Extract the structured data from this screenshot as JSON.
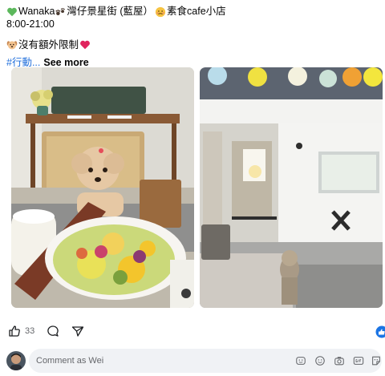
{
  "post": {
    "line1_text_a": "Wanaka",
    "line1_text_b": "灣仔景星街 (藍屋）",
    "line1_text_c": "素食cafe小店",
    "hours": "8:00-21:00",
    "line3_text": "沒有額外限制",
    "hashtag": "#行動...",
    "see_more": "See more"
  },
  "photos": [
    {
      "name": "dog-cafe-table-photo"
    },
    {
      "name": "cafe-storefront-photo"
    }
  ],
  "actions": {
    "like_count": "33"
  },
  "comment": {
    "placeholder": "Comment as Wei"
  },
  "colors": {
    "hashtag": "#216fdb",
    "like_blue": "#1b74e4",
    "muted": "#65676b",
    "comment_bg": "#f0f2f5"
  },
  "icons": {
    "heart": "green-heart-icon",
    "paws": "paw-prints-icon",
    "face": "face-icon",
    "dog": "dog-face-icon",
    "red_heart": "red-heart-icon",
    "like": "thumbs-up-icon",
    "comment": "comment-bubble-icon",
    "share": "share-arrow-icon",
    "badge": "like-reaction-badge-icon",
    "emoji": "emoji-icon",
    "smile": "smile-icon",
    "camera": "camera-icon",
    "gif": "gif-icon",
    "sticker": "sticker-icon"
  }
}
